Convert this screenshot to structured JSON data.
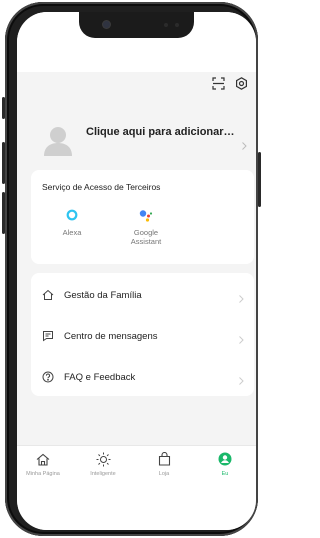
{
  "profile": {
    "title": "Clique aqui para adicionar n..."
  },
  "third_party": {
    "title": "Serviço de Acesso de Terceiros",
    "services": [
      {
        "label": "Alexa",
        "icon": "alexa-icon"
      },
      {
        "label": "Google\nAssistant",
        "icon": "google-assistant-icon"
      }
    ]
  },
  "menu": [
    {
      "label": "Gestão da Família",
      "icon": "home-icon"
    },
    {
      "label": "Centro de mensagens",
      "icon": "message-icon"
    },
    {
      "label": "FAQ e Feedback",
      "icon": "help-icon"
    }
  ],
  "tabs": [
    {
      "label": "Minha Página",
      "icon": "home-icon"
    },
    {
      "label": "Inteligente",
      "icon": "sun-icon"
    },
    {
      "label": "Loja",
      "icon": "shopping-bag-icon"
    },
    {
      "label": "Eu",
      "icon": "person-icon",
      "active": true
    }
  ],
  "colors": {
    "accent": "#1ab86a",
    "alexa": "#2ec4f0",
    "background": "#f4f4f4"
  }
}
